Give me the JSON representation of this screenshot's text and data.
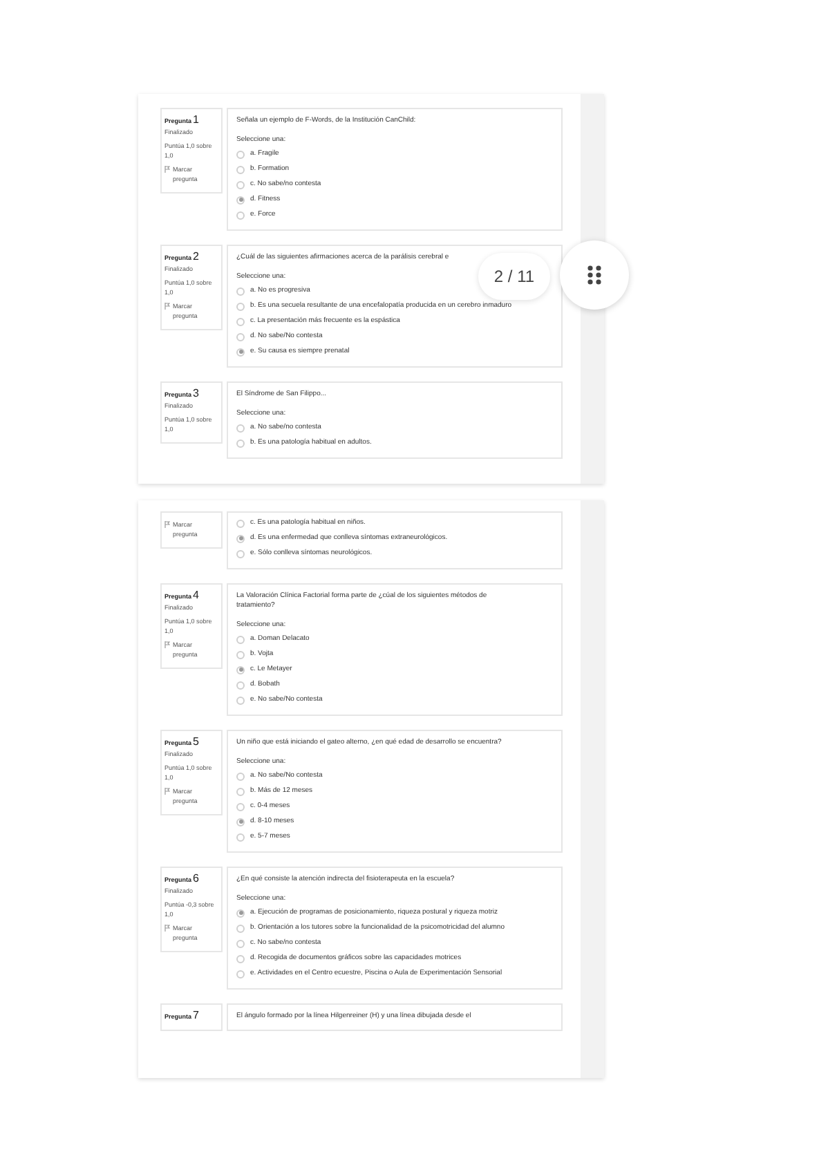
{
  "pages": [
    {
      "questions": [
        {
          "label": "Pregunta",
          "number": "1",
          "status": "Finalizado",
          "score": "Puntúa 1,0 sobre 1,0",
          "flag": "Marcar pregunta",
          "text": "Señala un ejemplo de F-Words, de la Institución CanChild:",
          "prompt": "Seleccione una:",
          "options": [
            {
              "text": "a. Fragile",
              "selected": false
            },
            {
              "text": "b. Formation",
              "selected": false
            },
            {
              "text": "c. No sabe/no contesta",
              "selected": false
            },
            {
              "text": "d. Fitness",
              "selected": true
            },
            {
              "text": "e. Force",
              "selected": false
            }
          ]
        },
        {
          "label": "Pregunta",
          "number": "2",
          "status": "Finalizado",
          "score": "Puntúa 1,0 sobre 1,0",
          "flag": "Marcar pregunta",
          "text": "¿Cuál de las siguientes afirmaciones acerca de la parálisis cerebral e",
          "prompt": "Seleccione una:",
          "options": [
            {
              "text": "a. No es progresiva",
              "selected": false
            },
            {
              "text": "b. Es una secuela resultante de una encefalopatía producida en un cerebro inmaduro",
              "selected": false
            },
            {
              "text": "c. La presentación más frecuente es la espástica",
              "selected": false
            },
            {
              "text": "d. No sabe/No contesta",
              "selected": false
            },
            {
              "text": "e. Su causa es siempre prenatal",
              "selected": true
            }
          ]
        },
        {
          "label": "Pregunta",
          "number": "3",
          "status": "Finalizado",
          "score": "Puntúa 1,0 sobre 1,0",
          "text": "El Síndrome de San Filippo...",
          "prompt": "Seleccione una:",
          "options": [
            {
              "text": "a. No sabe/no contesta",
              "selected": false
            },
            {
              "text": "b. Es una patología habitual en adultos.",
              "selected": false
            }
          ]
        }
      ]
    },
    {
      "questions": [
        {
          "flag": "Marcar pregunta",
          "options": [
            {
              "text": "c. Es una patología habitual en niños.",
              "selected": false
            },
            {
              "text": "d. Es una enfermedad que conlleva síntomas extraneurológicos.",
              "selected": true
            },
            {
              "text": "e. Sólo conlleva síntomas neurológicos.",
              "selected": false
            }
          ]
        },
        {
          "label": "Pregunta",
          "number": "4",
          "status": "Finalizado",
          "score": "Puntúa 1,0 sobre 1,0",
          "flag": "Marcar pregunta",
          "text": "La Valoración Clínica Factorial forma parte de ¿cúal de los siguientes métodos de tratamiento?",
          "prompt": "Seleccione una:",
          "options": [
            {
              "text": "a. Doman Delacato",
              "selected": false
            },
            {
              "text": "b. Vojta",
              "selected": false
            },
            {
              "text": "c. Le Metayer",
              "selected": true
            },
            {
              "text": "d. Bobath",
              "selected": false
            },
            {
              "text": "e. No sabe/No contesta",
              "selected": false
            }
          ]
        },
        {
          "label": "Pregunta",
          "number": "5",
          "status": "Finalizado",
          "score": "Puntúa 1,0 sobre 1,0",
          "flag": "Marcar pregunta",
          "text": "Un niño que está iniciando el gateo alterno, ¿en qué edad de desarrollo se encuentra?",
          "prompt": "Seleccione una:",
          "options": [
            {
              "text": "a. No sabe/No contesta",
              "selected": false
            },
            {
              "text": "b. Más de 12 meses",
              "selected": false
            },
            {
              "text": "c. 0-4 meses",
              "selected": false
            },
            {
              "text": "d. 8-10 meses",
              "selected": true
            },
            {
              "text": "e. 5-7 meses",
              "selected": false
            }
          ]
        },
        {
          "label": "Pregunta",
          "number": "6",
          "status": "Finalizado",
          "score": "Puntúa -0,3 sobre 1,0",
          "flag": "Marcar pregunta",
          "text": "¿En qué consiste la atención indirecta del fisioterapeuta en la escuela?",
          "prompt": "Seleccione una:",
          "options": [
            {
              "text": "a. Ejecución de programas de posicionamiento, riqueza postural y riqueza motriz",
              "selected": true
            },
            {
              "text": "b. Orientación a los tutores sobre la funcionalidad de la psicomotricidad del alumno",
              "selected": false
            },
            {
              "text": "c. No sabe/no contesta",
              "selected": false
            },
            {
              "text": "d. Recogida de documentos gráficos sobre las capacidades motrices",
              "selected": false
            },
            {
              "text": "e. Actividades en el Centro ecuestre, Piscina o Aula de Experimentación Sensorial",
              "selected": false
            }
          ]
        },
        {
          "label": "Pregunta",
          "number": "7",
          "text": "El ángulo formado por la línea Hilgenreiner (H) y una línea dibujada desde el"
        }
      ]
    }
  ],
  "page_indicator": "2 / 11"
}
